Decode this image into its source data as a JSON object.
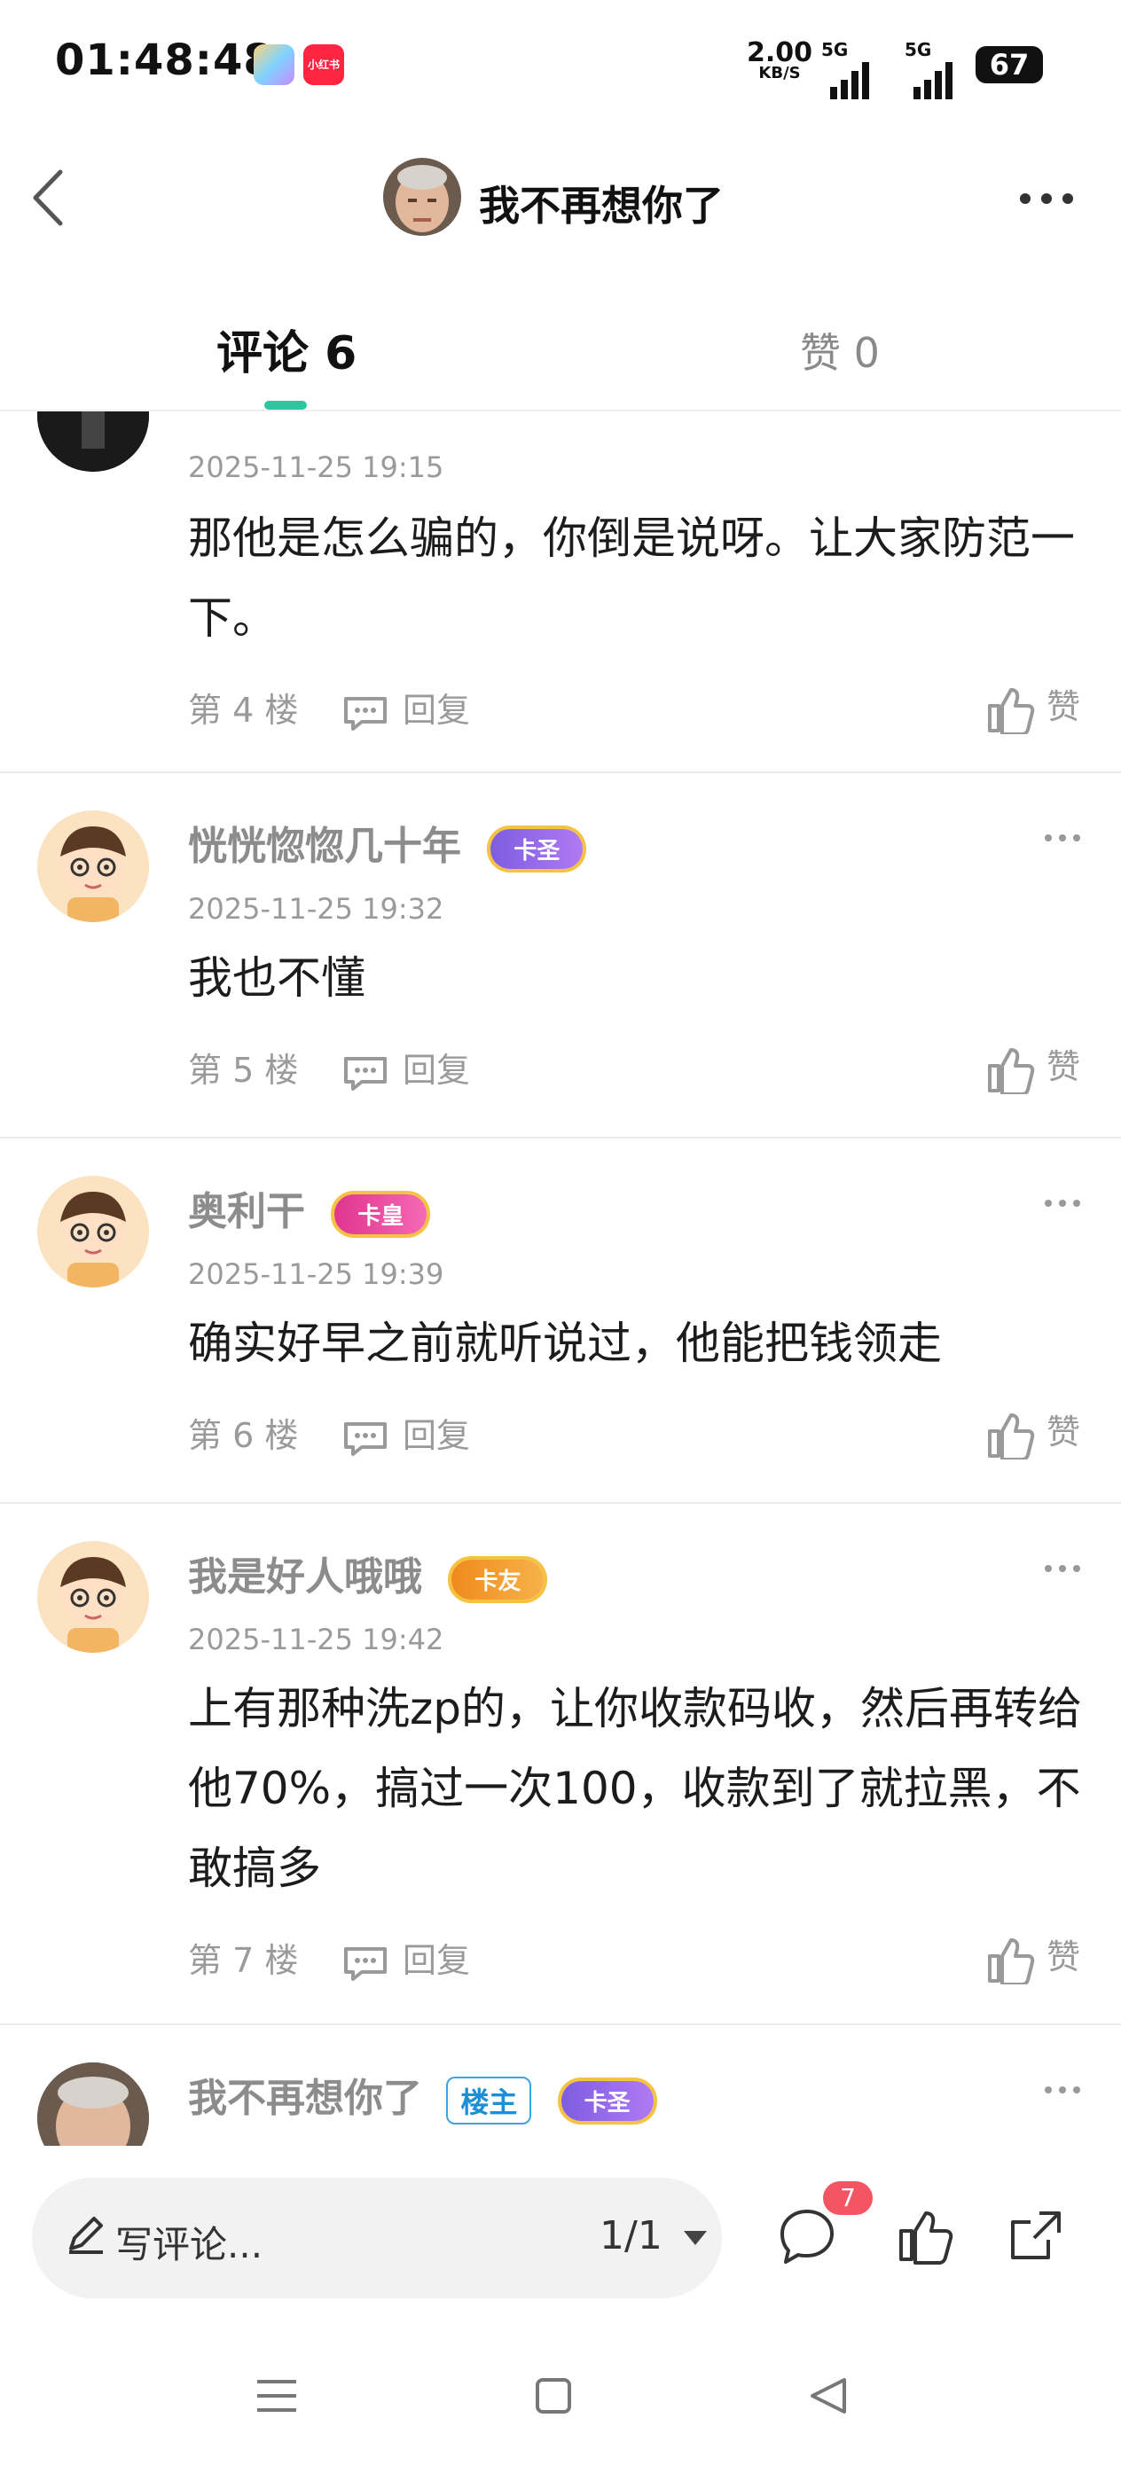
{
  "status_bar": {
    "time": "01:48:48",
    "net_speed": "2.00",
    "net_unit": "KB/S",
    "signal1_label": "5G",
    "signal2_label": "5G",
    "battery": "67",
    "app_icon_label": "小红书"
  },
  "header": {
    "title": "我不再想你了"
  },
  "tabs": {
    "comments_label": "评论 6",
    "likes_label": "赞 0"
  },
  "comments": [
    {
      "username": "",
      "date": "2025-11-25 19:15",
      "text": "那他是怎么骗的，你倒是说呀。让大家防范一下。",
      "floor": "第 4 楼",
      "reply_label": "回复",
      "like_label": "赞"
    },
    {
      "username": "恍恍惚惚几十年",
      "badge": "卡圣",
      "date": "2025-11-25 19:32",
      "text": "我也不懂",
      "floor": "第 5 楼",
      "reply_label": "回复",
      "like_label": "赞"
    },
    {
      "username": "奥利干",
      "badge": "卡皇",
      "date": "2025-11-25 19:39",
      "text": "确实好早之前就听说过，他能把钱领走",
      "floor": "第 6 楼",
      "reply_label": "回复",
      "like_label": "赞"
    },
    {
      "username": "我是好人哦哦",
      "badge": "卡友",
      "date": "2025-11-25 19:42",
      "text": "上有那种洗zp的，让你收款码收，然后再转给他70%，搞过一次100，收款到了就拉黑，不敢搞多",
      "floor": "第 7 楼",
      "reply_label": "回复",
      "like_label": "赞"
    },
    {
      "username": "我不再想你了",
      "owner_tag": "楼主",
      "badge": "卡圣"
    }
  ],
  "bottom_bar": {
    "write_placeholder": "写评论...",
    "page_indicator": "1/1",
    "comment_count": "7"
  },
  "colors": {
    "accent": "#2ec6a0",
    "badge_red": "#f45563",
    "owner_tag": "#1a8fd8"
  }
}
